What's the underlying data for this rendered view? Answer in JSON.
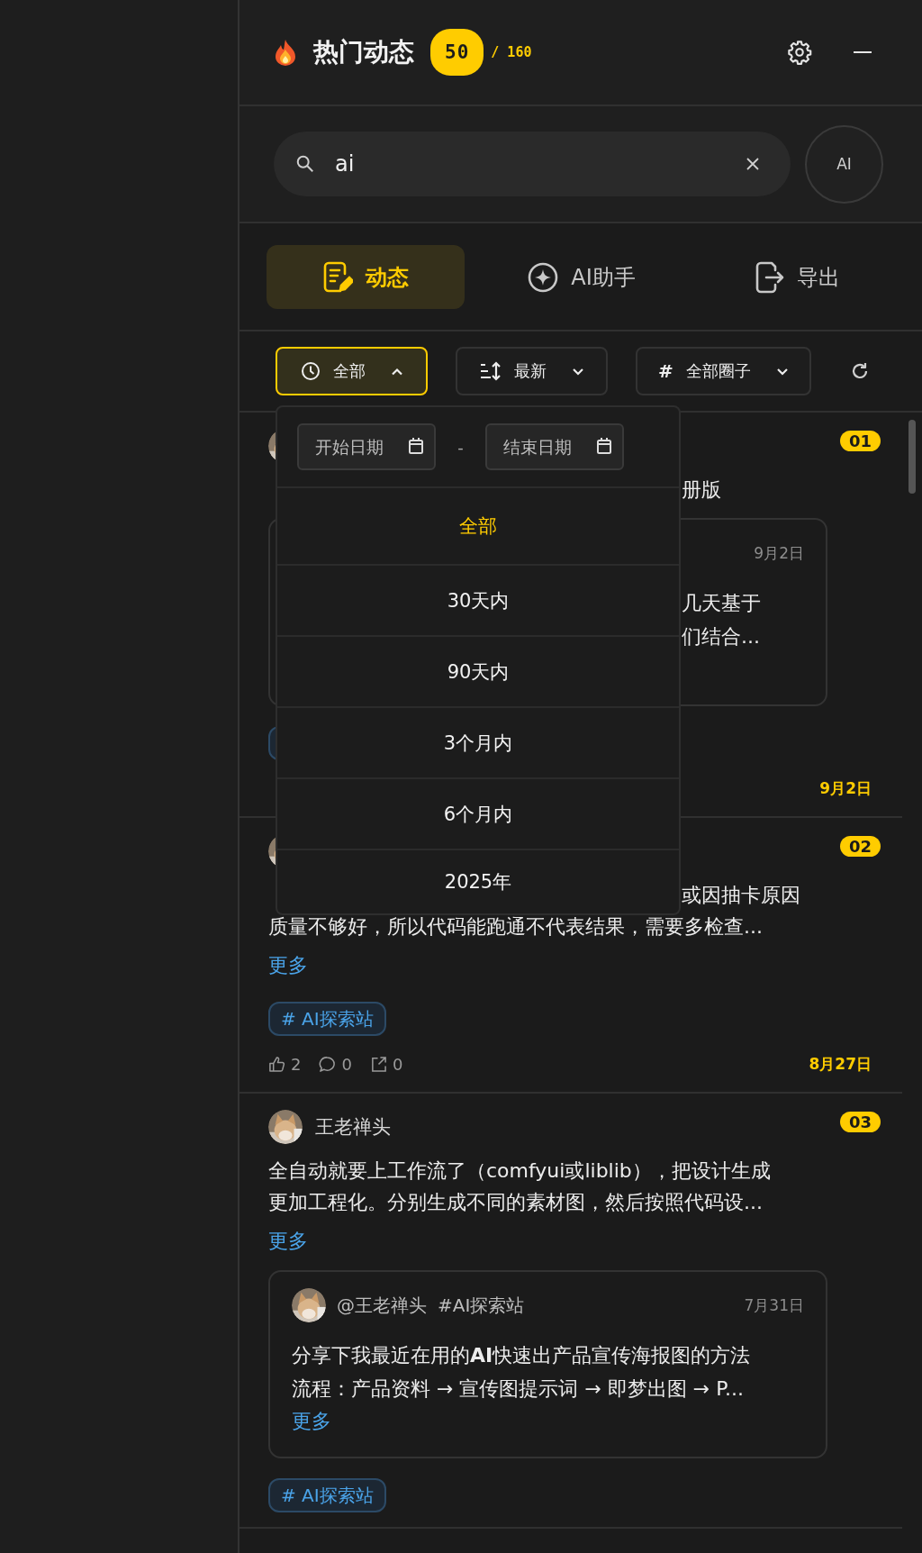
{
  "header": {
    "title": "热门动态",
    "count": "50",
    "total": "/ 160"
  },
  "search": {
    "value": "ai",
    "ai_button": "AI"
  },
  "tabs": [
    {
      "label": "动态",
      "selected": true
    },
    {
      "label": "AI助手",
      "selected": false
    },
    {
      "label": "导出",
      "selected": false
    }
  ],
  "filters": [
    {
      "kind": "time",
      "label": "全部",
      "expanded": true
    },
    {
      "kind": "sort",
      "label": "最新",
      "expanded": false
    },
    {
      "kind": "circle",
      "glyph": "#",
      "label": "全部圈子",
      "expanded": false
    }
  ],
  "time_menu": {
    "start_placeholder": "开始日期",
    "separator": "-",
    "end_placeholder": "结束日期",
    "options": [
      {
        "label": "全部",
        "selected": true
      },
      {
        "label": "30天内",
        "selected": false
      },
      {
        "label": "90天内",
        "selected": false
      },
      {
        "label": "3个月内",
        "selected": false
      },
      {
        "label": "6个月内",
        "selected": false
      },
      {
        "label": "2025年",
        "selected": false
      }
    ]
  },
  "posts": [
    {
      "rank": "01",
      "body_fragments": [
        "册版"
      ],
      "quote": {
        "date": "9月2日",
        "fragments": [
          "几天基于",
          "们结合..."
        ]
      },
      "tag": {
        "kind": "covered"
      },
      "footer": {
        "date": "9月2日"
      }
    },
    {
      "rank": "02",
      "body_fragments": [
        "或因抽卡原因"
      ],
      "body": [
        "质量不够好，所以代码能跑通不代表结果，需要多检查..."
      ],
      "more": "更多",
      "tag": {
        "kind": "label",
        "label": "# AI探索站"
      },
      "footer": {
        "likes": "2",
        "comments": "0",
        "shares": "0",
        "date": "8月27日"
      }
    },
    {
      "rank": "03",
      "author": "王老禅头",
      "body": [
        "全自动就要上工作流了（comfyui或liblib），把设计生成",
        "更加工程化。分别生成不同的素材图，然后按照代码设..."
      ],
      "more": "更多",
      "quote": {
        "author": "@王老禅头",
        "circle": "#AI探索站",
        "date": "7月31日",
        "lines": [
          "分享下我最近在用的**AI**快速出产品宣传海报图的方法",
          "流程：产品资料 → 宣传图提示词 → 即梦出图 → P..."
        ],
        "more": "更多"
      },
      "tag": {
        "kind": "label",
        "label": "# AI探索站"
      }
    }
  ]
}
